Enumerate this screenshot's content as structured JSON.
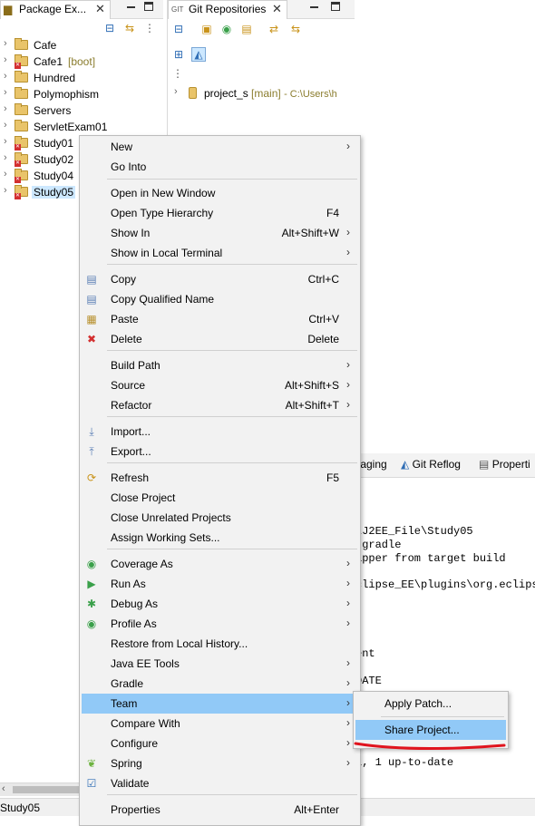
{
  "package_explorer": {
    "tab_label": "Package Ex...",
    "items": [
      {
        "label": "Cafe",
        "deco": "",
        "error": false
      },
      {
        "label": "Cafe1",
        "deco": "[boot]",
        "error": true
      },
      {
        "label": "Hundred",
        "deco": "",
        "error": false
      },
      {
        "label": "Polymophism",
        "deco": "",
        "error": false
      },
      {
        "label": "Servers",
        "deco": "",
        "error": false
      },
      {
        "label": "ServletExam01",
        "deco": "",
        "error": false
      },
      {
        "label": "Study01",
        "deco": "",
        "error": true
      },
      {
        "label": "Study02",
        "deco": "",
        "error": true
      },
      {
        "label": "Study04",
        "deco": "",
        "error": true
      },
      {
        "label": "Study05",
        "deco": "",
        "error": true,
        "selected": true
      }
    ]
  },
  "git_repositories": {
    "tab_label": "Git Repositories",
    "repo_name": "project_s",
    "repo_branch": "[main]",
    "repo_path": "- C:\\Users\\h"
  },
  "bottom_panel": {
    "tabs": [
      "Staging",
      "Git Reflog",
      "Properties"
    ],
    "tab_labels_visible": [
      "Staging",
      "Git Reflog",
      "Properti"
    ],
    "console_lines": [
      "\\J2EE_File\\Study05",
      ".gradle",
      "apper from target build",
      "clipse_EE\\plugins\\org.eclips",
      "ent",
      "DATE",
      "l, 1 up-to-date"
    ]
  },
  "status_bar": {
    "text": "Study05"
  },
  "context_menu": {
    "items": [
      {
        "label": "New",
        "accel": "",
        "submenu": true,
        "icon": ""
      },
      {
        "label": "Go Into",
        "accel": "",
        "submenu": false,
        "icon": ""
      },
      {
        "label": "Open in New Window",
        "accel": "",
        "submenu": false,
        "icon": ""
      },
      {
        "label": "Open Type Hierarchy",
        "accel": "F4",
        "submenu": false,
        "icon": ""
      },
      {
        "label": "Show In",
        "accel": "Alt+Shift+W",
        "submenu": true,
        "icon": ""
      },
      {
        "label": "Show in Local Terminal",
        "accel": "",
        "submenu": true,
        "icon": ""
      },
      {
        "label": "Copy",
        "accel": "Ctrl+C",
        "submenu": false,
        "icon": "copy-icon"
      },
      {
        "label": "Copy Qualified Name",
        "accel": "",
        "submenu": false,
        "icon": "copy-qualified-icon"
      },
      {
        "label": "Paste",
        "accel": "Ctrl+V",
        "submenu": false,
        "icon": "paste-icon"
      },
      {
        "label": "Delete",
        "accel": "Delete",
        "submenu": false,
        "icon": "delete-icon"
      },
      {
        "label": "Build Path",
        "accel": "",
        "submenu": true,
        "icon": ""
      },
      {
        "label": "Source",
        "accel": "Alt+Shift+S",
        "submenu": true,
        "icon": ""
      },
      {
        "label": "Refactor",
        "accel": "Alt+Shift+T",
        "submenu": true,
        "icon": ""
      },
      {
        "label": "Import...",
        "accel": "",
        "submenu": false,
        "icon": "import-icon"
      },
      {
        "label": "Export...",
        "accel": "",
        "submenu": false,
        "icon": "export-icon"
      },
      {
        "label": "Refresh",
        "accel": "F5",
        "submenu": false,
        "icon": "refresh-icon"
      },
      {
        "label": "Close Project",
        "accel": "",
        "submenu": false,
        "icon": ""
      },
      {
        "label": "Close Unrelated Projects",
        "accel": "",
        "submenu": false,
        "icon": ""
      },
      {
        "label": "Assign Working Sets...",
        "accel": "",
        "submenu": false,
        "icon": ""
      },
      {
        "label": "Coverage As",
        "accel": "",
        "submenu": true,
        "icon": "coverage-icon"
      },
      {
        "label": "Run As",
        "accel": "",
        "submenu": true,
        "icon": "run-icon"
      },
      {
        "label": "Debug As",
        "accel": "",
        "submenu": true,
        "icon": "debug-icon"
      },
      {
        "label": "Profile As",
        "accel": "",
        "submenu": true,
        "icon": "profile-icon"
      },
      {
        "label": "Restore from Local History...",
        "accel": "",
        "submenu": false,
        "icon": ""
      },
      {
        "label": "Java EE Tools",
        "accel": "",
        "submenu": true,
        "icon": ""
      },
      {
        "label": "Gradle",
        "accel": "",
        "submenu": true,
        "icon": ""
      },
      {
        "label": "Team",
        "accel": "",
        "submenu": true,
        "icon": "",
        "active": true
      },
      {
        "label": "Compare With",
        "accel": "",
        "submenu": true,
        "icon": ""
      },
      {
        "label": "Configure",
        "accel": "",
        "submenu": true,
        "icon": ""
      },
      {
        "label": "Spring",
        "accel": "",
        "submenu": true,
        "icon": "spring-icon"
      },
      {
        "label": "Validate",
        "accel": "",
        "submenu": false,
        "icon": "validate-icon"
      },
      {
        "label": "Properties",
        "accel": "Alt+Enter",
        "submenu": false,
        "icon": ""
      }
    ]
  },
  "team_submenu": {
    "items": [
      {
        "label": "Apply Patch..."
      },
      {
        "label": "Share Project...",
        "active": true
      }
    ]
  },
  "colors": {
    "menu_highlight": "#91c9f7",
    "selection": "#cde8ff",
    "annotation_red": "#e0141e"
  }
}
